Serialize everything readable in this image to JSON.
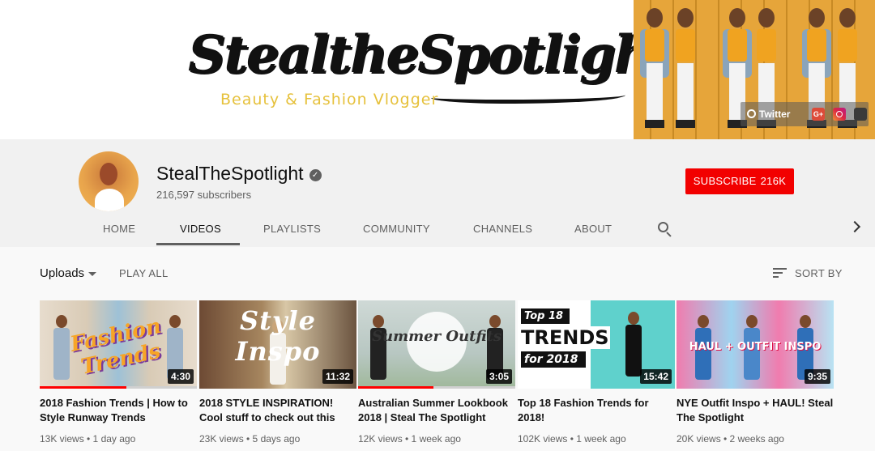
{
  "banner": {
    "logo_text": "StealtheSpotlight",
    "tagline": "Beauty & Fashion Vlogger",
    "links": {
      "twitter": "Twitter",
      "gplus": "G+"
    }
  },
  "channel": {
    "name": "StealTheSpotlight",
    "subscribers": "216,597 subscribers",
    "subscribe_label": "SUBSCRIBE",
    "subscribe_count": "216K"
  },
  "tabs": [
    "HOME",
    "VIDEOS",
    "PLAYLISTS",
    "COMMUNITY",
    "CHANNELS",
    "ABOUT"
  ],
  "toolbar": {
    "uploads_label": "Uploads",
    "play_all": "PLAY ALL",
    "sort_by": "SORT BY"
  },
  "thumbs": {
    "t1": "Fashion Trends",
    "t2": "Style Inspo",
    "t3": "Summer Outfits",
    "t4_line1": "Top 18",
    "t4_line2": "TRENDS",
    "t4_line3": "for 2018",
    "t5": "HAUL + OUTFIT INSPO"
  },
  "videos": [
    {
      "title": "2018 Fashion Trends | How to Style Runway Trends",
      "meta": "13K views • 1 day ago",
      "duration": "4:30",
      "watched": 0.55
    },
    {
      "title": "2018 STYLE INSPIRATION! Cool stuff to check out this",
      "meta": "23K views • 5 days ago",
      "duration": "11:32",
      "watched": 0
    },
    {
      "title": "Australian Summer Lookbook 2018 | Steal The Spotlight",
      "meta": "12K views • 1 week ago",
      "duration": "3:05",
      "watched": 0.48
    },
    {
      "title": "Top 18 Fashion Trends for 2018!",
      "meta": "102K views • 1 week ago",
      "duration": "15:42",
      "watched": 0
    },
    {
      "title": "NYE Outfit Inspo + HAUL! Steal The Spotlight",
      "meta": "20K views • 2 weeks ago",
      "duration": "9:35",
      "watched": 0
    }
  ],
  "colors": {
    "subscribe": "#f20000",
    "progress": "#ff0000",
    "tagline": "#e6c13c"
  }
}
